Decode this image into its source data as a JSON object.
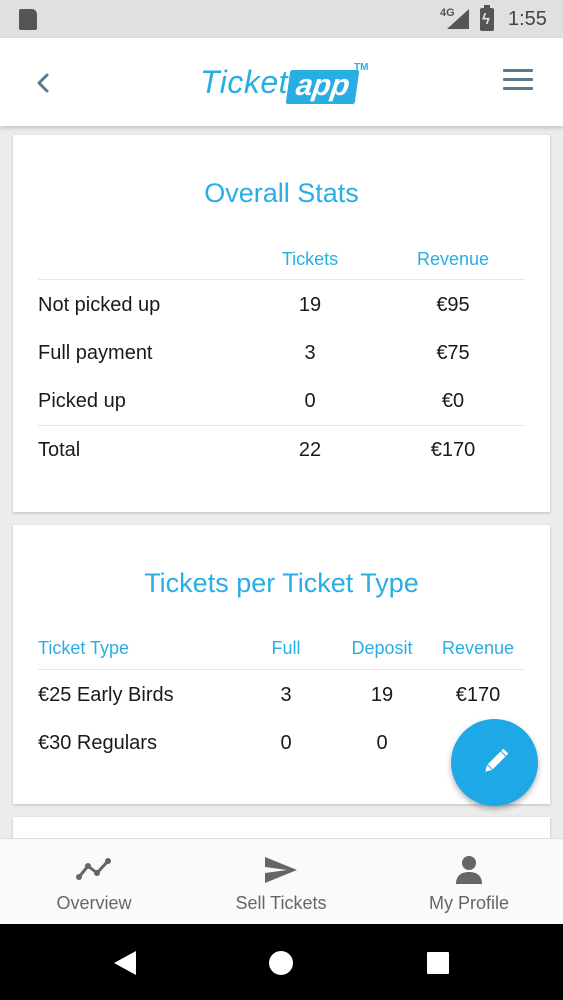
{
  "status_bar": {
    "network": "4G",
    "time": "1:55",
    "icons": [
      "sd-card-icon",
      "signal-icon",
      "battery-charging-icon"
    ]
  },
  "app_bar": {
    "logo_part1": "Ticket",
    "logo_part2": "app",
    "logo_tm": "TM",
    "icons": [
      "back-arrow-icon",
      "hamburger-menu-icon"
    ]
  },
  "overall_stats": {
    "title": "Overall Stats",
    "headers": [
      "Tickets",
      "Revenue"
    ],
    "rows": [
      {
        "label": "Not picked up",
        "tickets": "19",
        "revenue": "€95"
      },
      {
        "label": "Full payment",
        "tickets": "3",
        "revenue": "€75"
      },
      {
        "label": "Picked up",
        "tickets": "0",
        "revenue": "€0"
      },
      {
        "label": "Total",
        "tickets": "22",
        "revenue": "€170"
      }
    ]
  },
  "ticket_types": {
    "title": "Tickets per Ticket Type",
    "headers": [
      "Ticket Type",
      "Full",
      "Deposit",
      "Revenue"
    ],
    "rows": [
      {
        "type": "€25 Early Birds",
        "full": "3",
        "deposit": "19",
        "revenue": "€170"
      },
      {
        "type": "€30 Regulars",
        "full": "0",
        "deposit": "0",
        "revenue": ""
      }
    ]
  },
  "fab": {
    "icon": "edit-pencil-icon"
  },
  "bottom_nav": {
    "items": [
      {
        "label": "Overview",
        "icon": "trend-line-icon"
      },
      {
        "label": "Sell Tickets",
        "icon": "send-icon"
      },
      {
        "label": "My Profile",
        "icon": "person-icon"
      }
    ]
  },
  "system_nav": {
    "icons": [
      "back-triangle-icon",
      "home-circle-icon",
      "recents-square-icon"
    ]
  },
  "colors": {
    "accent": "#29aee4",
    "fab": "#1ea8e6",
    "statusbar": "#e0e0e0",
    "nav_label": "#666666"
  }
}
